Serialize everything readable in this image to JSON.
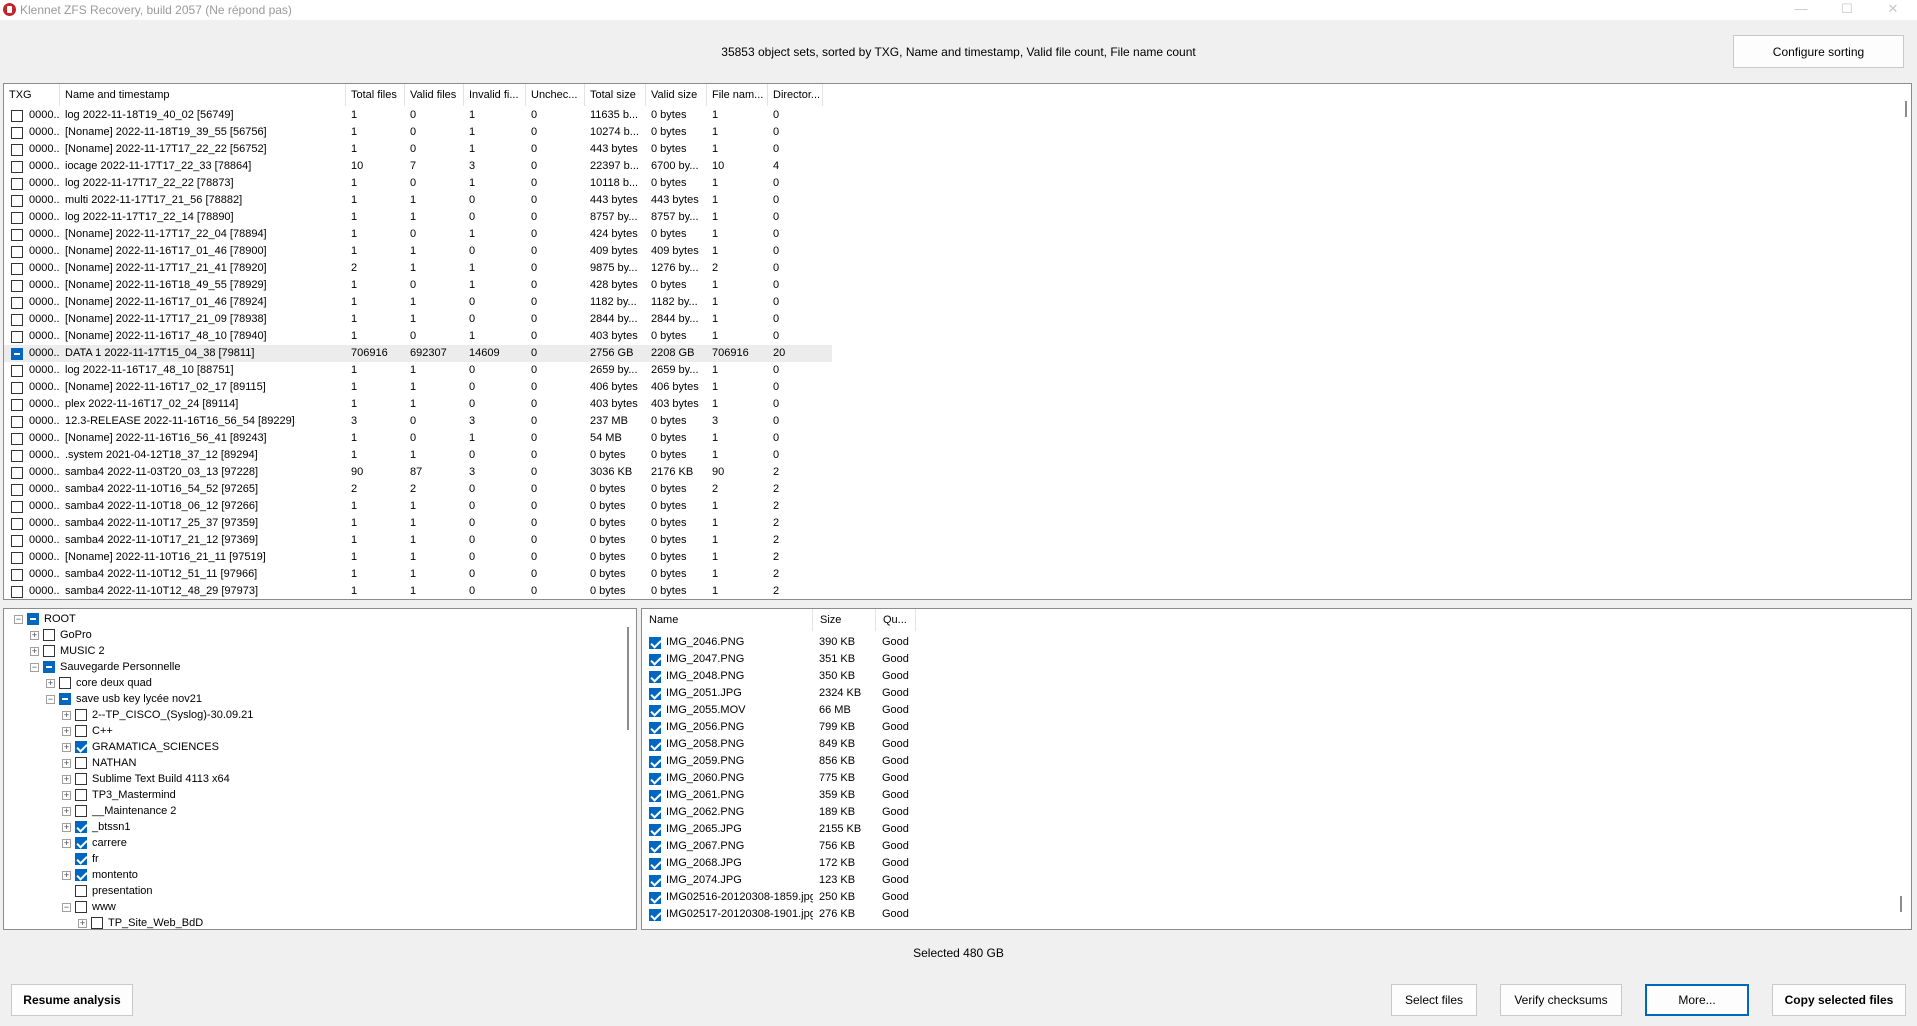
{
  "window": {
    "title": "Klennet ZFS Recovery, build 2057 (Ne répond pas)",
    "controls": {
      "minimize": "—",
      "maximize": "☐",
      "close": "✕"
    }
  },
  "header": {
    "summary": "35853 object sets, sorted by TXG, Name and timestamp, Valid file count, File name count",
    "configure_sorting": "Configure sorting"
  },
  "object_table": {
    "columns": [
      "TXG",
      "Name and timestamp",
      "Total files",
      "Valid files",
      "Invalid fi...",
      "Unchec...",
      "Total size",
      "Valid size",
      "File nam...",
      "Director..."
    ],
    "rows": [
      {
        "checked": "off",
        "txg": "0000...",
        "name": "log 2022-11-18T19_40_02 [56749]",
        "total": "1",
        "valid": "0",
        "invalid": "1",
        "unchecked": "0",
        "total_size": "11635 b...",
        "valid_size": "0 bytes",
        "file_names": "1",
        "dirs": "0"
      },
      {
        "checked": "off",
        "txg": "0000...",
        "name": "[Noname] 2022-11-18T19_39_55 [56756]",
        "total": "1",
        "valid": "0",
        "invalid": "1",
        "unchecked": "0",
        "total_size": "10274 b...",
        "valid_size": "0 bytes",
        "file_names": "1",
        "dirs": "0"
      },
      {
        "checked": "off",
        "txg": "0000...",
        "name": "[Noname] 2022-11-17T17_22_22 [56752]",
        "total": "1",
        "valid": "0",
        "invalid": "1",
        "unchecked": "0",
        "total_size": "443 bytes",
        "valid_size": "0 bytes",
        "file_names": "1",
        "dirs": "0"
      },
      {
        "checked": "off",
        "txg": "0000...",
        "name": "iocage 2022-11-17T17_22_33 [78864]",
        "total": "10",
        "valid": "7",
        "invalid": "3",
        "unchecked": "0",
        "total_size": "22397 b...",
        "valid_size": "6700 by...",
        "file_names": "10",
        "dirs": "4"
      },
      {
        "checked": "off",
        "txg": "0000...",
        "name": "log 2022-11-17T17_22_22 [78873]",
        "total": "1",
        "valid": "0",
        "invalid": "1",
        "unchecked": "0",
        "total_size": "10118 b...",
        "valid_size": "0 bytes",
        "file_names": "1",
        "dirs": "0"
      },
      {
        "checked": "off",
        "txg": "0000...",
        "name": "multi 2022-11-17T17_21_56 [78882]",
        "total": "1",
        "valid": "1",
        "invalid": "0",
        "unchecked": "0",
        "total_size": "443 bytes",
        "valid_size": "443 bytes",
        "file_names": "1",
        "dirs": "0"
      },
      {
        "checked": "off",
        "txg": "0000...",
        "name": "log 2022-11-17T17_22_14 [78890]",
        "total": "1",
        "valid": "1",
        "invalid": "0",
        "unchecked": "0",
        "total_size": "8757 by...",
        "valid_size": "8757 by...",
        "file_names": "1",
        "dirs": "0"
      },
      {
        "checked": "off",
        "txg": "0000...",
        "name": "[Noname] 2022-11-17T17_22_04 [78894]",
        "total": "1",
        "valid": "0",
        "invalid": "1",
        "unchecked": "0",
        "total_size": "424 bytes",
        "valid_size": "0 bytes",
        "file_names": "1",
        "dirs": "0"
      },
      {
        "checked": "off",
        "txg": "0000...",
        "name": "[Noname] 2022-11-16T17_01_46 [78900]",
        "total": "1",
        "valid": "1",
        "invalid": "0",
        "unchecked": "0",
        "total_size": "409 bytes",
        "valid_size": "409 bytes",
        "file_names": "1",
        "dirs": "0"
      },
      {
        "checked": "off",
        "txg": "0000...",
        "name": "[Noname] 2022-11-17T17_21_41 [78920]",
        "total": "2",
        "valid": "1",
        "invalid": "1",
        "unchecked": "0",
        "total_size": "9875 by...",
        "valid_size": "1276 by...",
        "file_names": "2",
        "dirs": "0"
      },
      {
        "checked": "off",
        "txg": "0000...",
        "name": "[Noname] 2022-11-16T18_49_55 [78929]",
        "total": "1",
        "valid": "0",
        "invalid": "1",
        "unchecked": "0",
        "total_size": "428 bytes",
        "valid_size": "0 bytes",
        "file_names": "1",
        "dirs": "0"
      },
      {
        "checked": "off",
        "txg": "0000...",
        "name": "[Noname] 2022-11-16T17_01_46 [78924]",
        "total": "1",
        "valid": "1",
        "invalid": "0",
        "unchecked": "0",
        "total_size": "1182 by...",
        "valid_size": "1182 by...",
        "file_names": "1",
        "dirs": "0"
      },
      {
        "checked": "off",
        "txg": "0000...",
        "name": "[Noname] 2022-11-17T17_21_09 [78938]",
        "total": "1",
        "valid": "1",
        "invalid": "0",
        "unchecked": "0",
        "total_size": "2844 by...",
        "valid_size": "2844 by...",
        "file_names": "1",
        "dirs": "0"
      },
      {
        "checked": "off",
        "txg": "0000...",
        "name": "[Noname] 2022-11-16T17_48_10 [78940]",
        "total": "1",
        "valid": "0",
        "invalid": "1",
        "unchecked": "0",
        "total_size": "403 bytes",
        "valid_size": "0 bytes",
        "file_names": "1",
        "dirs": "0"
      },
      {
        "checked": "partial",
        "selected": true,
        "txg": "0000...",
        "name": "DATA 1 2022-11-17T15_04_38 [79811]",
        "total": "706916",
        "valid": "692307",
        "invalid": "14609",
        "unchecked": "0",
        "total_size": "2756 GB",
        "valid_size": "2208 GB",
        "file_names": "706916",
        "dirs": "20"
      },
      {
        "checked": "off",
        "txg": "0000...",
        "name": "log 2022-11-16T17_48_10 [88751]",
        "total": "1",
        "valid": "1",
        "invalid": "0",
        "unchecked": "0",
        "total_size": "2659 by...",
        "valid_size": "2659 by...",
        "file_names": "1",
        "dirs": "0"
      },
      {
        "checked": "off",
        "txg": "0000...",
        "name": "[Noname] 2022-11-16T17_02_17 [89115]",
        "total": "1",
        "valid": "1",
        "invalid": "0",
        "unchecked": "0",
        "total_size": "406 bytes",
        "valid_size": "406 bytes",
        "file_names": "1",
        "dirs": "0"
      },
      {
        "checked": "off",
        "txg": "0000...",
        "name": "plex 2022-11-16T17_02_24 [89114]",
        "total": "1",
        "valid": "1",
        "invalid": "0",
        "unchecked": "0",
        "total_size": "403 bytes",
        "valid_size": "403 bytes",
        "file_names": "1",
        "dirs": "0"
      },
      {
        "checked": "off",
        "txg": "0000...",
        "name": "12.3-RELEASE 2022-11-16T16_56_54 [89229]",
        "total": "3",
        "valid": "0",
        "invalid": "3",
        "unchecked": "0",
        "total_size": "237 MB",
        "valid_size": "0 bytes",
        "file_names": "3",
        "dirs": "0"
      },
      {
        "checked": "off",
        "txg": "0000...",
        "name": "[Noname] 2022-11-16T16_56_41 [89243]",
        "total": "1",
        "valid": "0",
        "invalid": "1",
        "unchecked": "0",
        "total_size": "54 MB",
        "valid_size": "0 bytes",
        "file_names": "1",
        "dirs": "0"
      },
      {
        "checked": "off",
        "txg": "0000...",
        "name": ".system 2021-04-12T18_37_12 [89294]",
        "total": "1",
        "valid": "1",
        "invalid": "0",
        "unchecked": "0",
        "total_size": "0 bytes",
        "valid_size": "0 bytes",
        "file_names": "1",
        "dirs": "0"
      },
      {
        "checked": "off",
        "txg": "0000...",
        "name": "samba4 2022-11-03T20_03_13 [97228]",
        "total": "90",
        "valid": "87",
        "invalid": "3",
        "unchecked": "0",
        "total_size": "3036 KB",
        "valid_size": "2176 KB",
        "file_names": "90",
        "dirs": "2"
      },
      {
        "checked": "off",
        "txg": "0000...",
        "name": "samba4 2022-11-10T16_54_52 [97265]",
        "total": "2",
        "valid": "2",
        "invalid": "0",
        "unchecked": "0",
        "total_size": "0 bytes",
        "valid_size": "0 bytes",
        "file_names": "2",
        "dirs": "2"
      },
      {
        "checked": "off",
        "txg": "0000...",
        "name": "samba4 2022-11-10T18_06_12 [97266]",
        "total": "1",
        "valid": "1",
        "invalid": "0",
        "unchecked": "0",
        "total_size": "0 bytes",
        "valid_size": "0 bytes",
        "file_names": "1",
        "dirs": "2"
      },
      {
        "checked": "off",
        "txg": "0000...",
        "name": "samba4 2022-11-10T17_25_37 [97359]",
        "total": "1",
        "valid": "1",
        "invalid": "0",
        "unchecked": "0",
        "total_size": "0 bytes",
        "valid_size": "0 bytes",
        "file_names": "1",
        "dirs": "2"
      },
      {
        "checked": "off",
        "txg": "0000...",
        "name": "samba4 2022-11-10T17_21_12 [97369]",
        "total": "1",
        "valid": "1",
        "invalid": "0",
        "unchecked": "0",
        "total_size": "0 bytes",
        "valid_size": "0 bytes",
        "file_names": "1",
        "dirs": "2"
      },
      {
        "checked": "off",
        "txg": "0000...",
        "name": "[Noname] 2022-11-10T16_21_11 [97519]",
        "total": "1",
        "valid": "1",
        "invalid": "0",
        "unchecked": "0",
        "total_size": "0 bytes",
        "valid_size": "0 bytes",
        "file_names": "1",
        "dirs": "2"
      },
      {
        "checked": "off",
        "txg": "0000...",
        "name": "samba4 2022-11-10T12_51_11 [97966]",
        "total": "1",
        "valid": "1",
        "invalid": "0",
        "unchecked": "0",
        "total_size": "0 bytes",
        "valid_size": "0 bytes",
        "file_names": "1",
        "dirs": "2"
      },
      {
        "checked": "off",
        "txg": "0000...",
        "name": "samba4 2022-11-10T12_48_29 [97973]",
        "total": "1",
        "valid": "1",
        "invalid": "0",
        "unchecked": "0",
        "total_size": "0 bytes",
        "valid_size": "0 bytes",
        "file_names": "1",
        "dirs": "2"
      }
    ]
  },
  "tree": {
    "nodes": [
      {
        "label": "ROOT",
        "depth": 0,
        "expander": "−",
        "checked": "partial"
      },
      {
        "label": "GoPro",
        "depth": 1,
        "expander": "+",
        "checked": "off"
      },
      {
        "label": "MUSIC 2",
        "depth": 1,
        "expander": "+",
        "checked": "off"
      },
      {
        "label": "Sauvegarde Personnelle",
        "depth": 1,
        "expander": "−",
        "checked": "partial"
      },
      {
        "label": "core deux quad",
        "depth": 2,
        "expander": "+",
        "checked": "off"
      },
      {
        "label": "save usb key lycée nov21",
        "depth": 2,
        "expander": "−",
        "checked": "partial"
      },
      {
        "label": "2--TP_CISCO_(Syslog)-30.09.21",
        "depth": 3,
        "expander": "+",
        "checked": "off"
      },
      {
        "label": "C++",
        "depth": 3,
        "expander": "+",
        "checked": "off"
      },
      {
        "label": "GRAMATICA_SCIENCES",
        "depth": 3,
        "expander": "+",
        "checked": "on"
      },
      {
        "label": "NATHAN",
        "depth": 3,
        "expander": "+",
        "checked": "off"
      },
      {
        "label": "Sublime Text Build 4113 x64",
        "depth": 3,
        "expander": "+",
        "checked": "off"
      },
      {
        "label": "TP3_Mastermind",
        "depth": 3,
        "expander": "+",
        "checked": "off"
      },
      {
        "label": "__Maintenance 2",
        "depth": 3,
        "expander": "+",
        "checked": "off"
      },
      {
        "label": "_btssn1",
        "depth": 3,
        "expander": "+",
        "checked": "on"
      },
      {
        "label": "carrere",
        "depth": 3,
        "expander": "+",
        "checked": "on"
      },
      {
        "label": "fr",
        "depth": 3,
        "expander": "",
        "checked": "on"
      },
      {
        "label": "montento",
        "depth": 3,
        "expander": "+",
        "checked": "on"
      },
      {
        "label": "presentation",
        "depth": 3,
        "expander": "",
        "checked": "off"
      },
      {
        "label": "www",
        "depth": 3,
        "expander": "−",
        "checked": "off"
      },
      {
        "label": "TP_Site_Web_BdD",
        "depth": 4,
        "expander": "+",
        "checked": "off"
      }
    ]
  },
  "files": {
    "columns": [
      "Name",
      "Size",
      "Qu..."
    ],
    "rows": [
      {
        "name": "IMG_2046.PNG",
        "size": "390 KB",
        "quality": "Good"
      },
      {
        "name": "IMG_2047.PNG",
        "size": "351 KB",
        "quality": "Good"
      },
      {
        "name": "IMG_2048.PNG",
        "size": "350 KB",
        "quality": "Good"
      },
      {
        "name": "IMG_2051.JPG",
        "size": "2324 KB",
        "quality": "Good"
      },
      {
        "name": "IMG_2055.MOV",
        "size": "66 MB",
        "quality": "Good"
      },
      {
        "name": "IMG_2056.PNG",
        "size": "799 KB",
        "quality": "Good"
      },
      {
        "name": "IMG_2058.PNG",
        "size": "849 KB",
        "quality": "Good"
      },
      {
        "name": "IMG_2059.PNG",
        "size": "856 KB",
        "quality": "Good"
      },
      {
        "name": "IMG_2060.PNG",
        "size": "775 KB",
        "quality": "Good"
      },
      {
        "name": "IMG_2061.PNG",
        "size": "359 KB",
        "quality": "Good"
      },
      {
        "name": "IMG_2062.PNG",
        "size": "189 KB",
        "quality": "Good"
      },
      {
        "name": "IMG_2065.JPG",
        "size": "2155 KB",
        "quality": "Good"
      },
      {
        "name": "IMG_2067.PNG",
        "size": "756 KB",
        "quality": "Good"
      },
      {
        "name": "IMG_2068.JPG",
        "size": "172 KB",
        "quality": "Good"
      },
      {
        "name": "IMG_2074.JPG",
        "size": "123 KB",
        "quality": "Good"
      },
      {
        "name": "IMG02516-20120308-1859.jpg",
        "size": "250 KB",
        "quality": "Good"
      },
      {
        "name": "IMG02517-20120308-1901.jpg",
        "size": "276 KB",
        "quality": "Good"
      }
    ]
  },
  "footer": {
    "selected_total": "Selected 480 GB",
    "resume_analysis": "Resume analysis",
    "select_files": "Select files",
    "verify_checksums": "Verify checksums",
    "more": "More...",
    "copy_selected_files": "Copy selected files"
  },
  "colors": {
    "accent": "#0067c0",
    "selected_row": "#ececec",
    "title_text": "#9a9a9a"
  }
}
